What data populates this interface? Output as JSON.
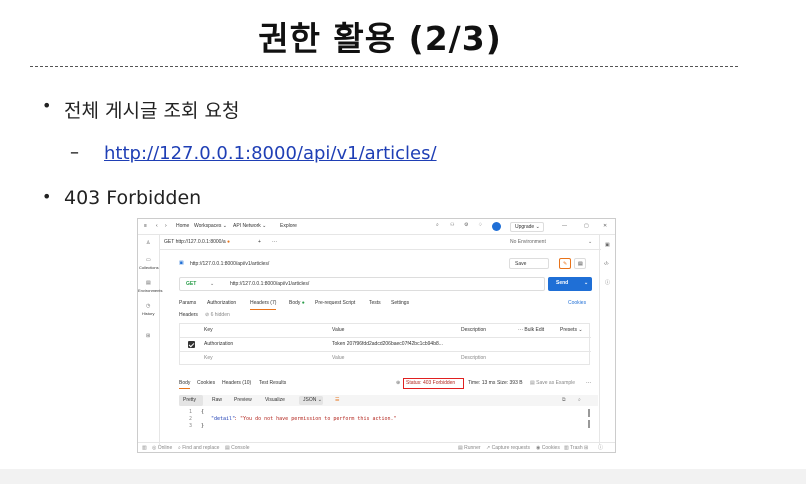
{
  "slide": {
    "title": "권한 활용 (2/3)",
    "bullet1": "전체 게시글 조회 요청",
    "bullet_dot": "•",
    "sub_dash": "–",
    "link": "http://127.0.0.1:8000/api/v1/articles/",
    "bullet2": "403 Forbidden"
  },
  "postman": {
    "topbar": {
      "menu_icon": "≡",
      "back": "‹",
      "forward": "›",
      "home": "Home",
      "workspaces": "Workspaces ⌄",
      "api_network": "API Network ⌄",
      "explore": "Explore",
      "upgrade": "Upgrade ⌄",
      "win_min": "—",
      "win_max": "▢",
      "win_close": "✕"
    },
    "sidebar": {
      "collections": "Collections",
      "environments": "Environments",
      "history": "History"
    },
    "tabs": {
      "request_tab": "GET http://127.0.0.1:8000/a",
      "plus": "+",
      "more": "···",
      "no_env": "No Environment"
    },
    "request": {
      "name": "http://127.0.0.1:8000/api/v1/articles/",
      "save": "Save",
      "method": "GET",
      "url": "http://127.0.0.1:8000/api/v1/articles/",
      "send": "Send",
      "subtabs": [
        "Params",
        "Authorization",
        "Headers (7)",
        "Body",
        "Pre-request Script",
        "Tests",
        "Settings"
      ],
      "cookies": "Cookies",
      "headers_label": "Headers",
      "hidden": "⊘ 6 hidden"
    },
    "table": {
      "col_key": "Key",
      "col_value": "Value",
      "col_desc": "Description",
      "bulk_edit": "Bulk Edit",
      "presets": "Presets ⌄",
      "row1_key": "Authorization",
      "row1_value": "Token 207f96fdd2adcd206baec07f42bc1cb94b8...",
      "row2_key": "Key",
      "row2_value": "Value",
      "row2_desc": "Description"
    },
    "response": {
      "tabs": [
        "Body",
        "Cookies",
        "Headers (10)",
        "Test Results"
      ],
      "status": "Status: 403 Forbidden",
      "time": "Time: 13 ms",
      "size": "Size: 393 B",
      "save_example": "Save as Example",
      "more": "···",
      "view_tabs": [
        "Pretty",
        "Raw",
        "Preview",
        "Visualize"
      ],
      "format": "JSON ⌄",
      "line1": "{",
      "line2_key": "\"detail\"",
      "line2_rest": ": \"You do not have permission to perform this action.\"",
      "line3": "}",
      "ln1": "1",
      "ln2": "2",
      "ln3": "3"
    },
    "bottombar": {
      "online": "Online",
      "find": "Find and replace",
      "console": "Console",
      "runner": "Runner",
      "capture": "Capture requests",
      "cookies": "Cookies",
      "trash": "Trash"
    }
  }
}
